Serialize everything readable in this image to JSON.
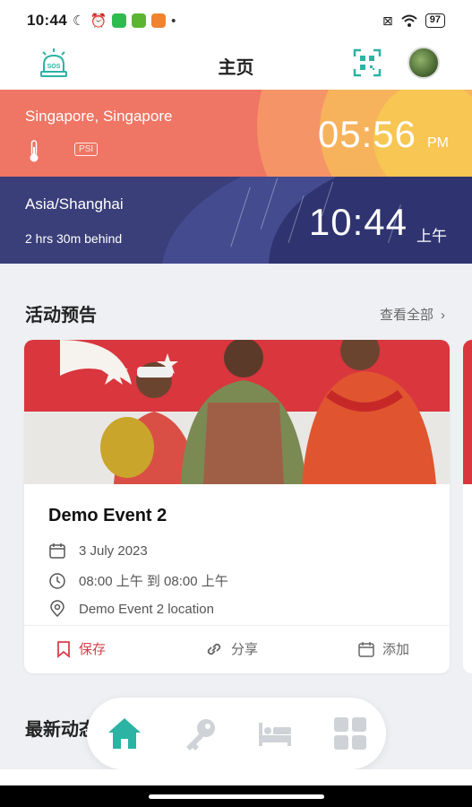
{
  "status_bar": {
    "time": "10:44",
    "battery": "97",
    "colors": {
      "wechat": "#2dbb4f",
      "app2": "#5cb531",
      "app3": "#f0832f"
    }
  },
  "header": {
    "title": "主页"
  },
  "clocks": {
    "local": {
      "city": "Singapore, Singapore",
      "time": "05:56",
      "ampm": "PM",
      "psi_label": "PSI"
    },
    "other": {
      "timezone": "Asia/Shanghai",
      "offset": "2 hrs 30m behind",
      "time": "10:44",
      "ampm": "上午"
    }
  },
  "events": {
    "section_title": "活动预告",
    "see_all": "查看全部",
    "card": {
      "title": "Demo Event 2",
      "date": "3 July 2023",
      "time": "08:00 上午 到 08:00 上午",
      "location": "Demo Event 2 location",
      "actions": {
        "save": "保存",
        "share": "分享",
        "add": "添加"
      }
    }
  },
  "latest": {
    "title": "最新动态"
  },
  "colors": {
    "accent": "#2bb3a3",
    "save": "#d6404a",
    "sg_card": "#ef7564",
    "sh_card": "#3a3f7a"
  }
}
